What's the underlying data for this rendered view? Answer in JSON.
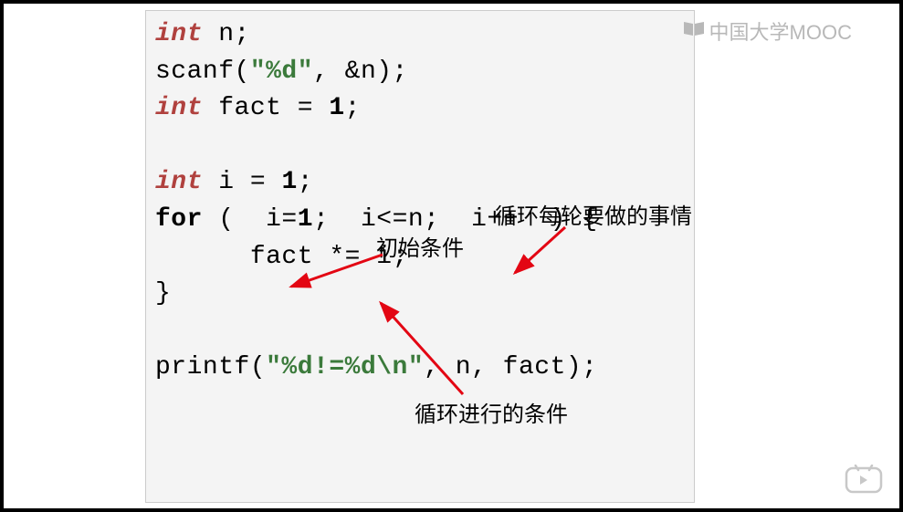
{
  "code": {
    "line1_type": "int",
    "line1_rest": " n;",
    "line2": "",
    "line3_a": "scanf(",
    "line3_str": "\"%d\"",
    "line3_b": ", &n);",
    "line4_type": "int",
    "line4_a": " fact = ",
    "line4_num": "1",
    "line4_b": ";",
    "line5": "",
    "line6_type": "int",
    "line6_a": " i = ",
    "line6_num": "1",
    "line6_b": ";",
    "line7_for": "for",
    "line7_a": " (  i=",
    "line7_num1": "1",
    "line7_b": ";  i<=n;  i++  ) {",
    "line8": "      fact *= i;",
    "line9": "}",
    "line10": "",
    "line11_a": "printf(",
    "line11_str": "\"%d!=%d\\n\"",
    "line11_b": ", n, fact);"
  },
  "annotations": {
    "init": "初始条件",
    "body": "循环每轮要做的事情",
    "cond": "循环进行的条件"
  },
  "watermark": {
    "text": "中国大学MOOC"
  }
}
